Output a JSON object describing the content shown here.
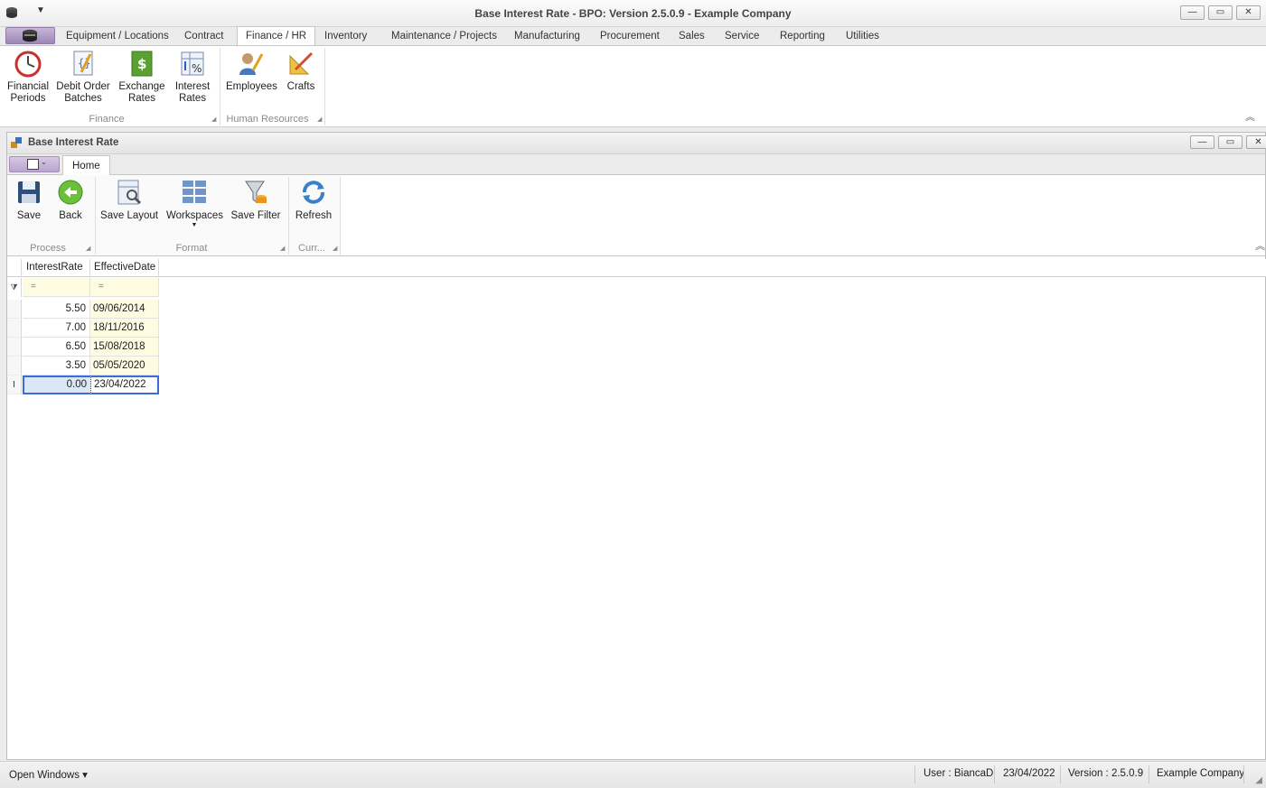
{
  "window": {
    "title": "Base Interest Rate - BPO: Version 2.5.0.9 - Example Company",
    "minimize": "—",
    "maximize": "▭",
    "close": "✕"
  },
  "main_tabs": [
    {
      "label": "Equipment / Locations"
    },
    {
      "label": "Contract"
    },
    {
      "label": "Finance / HR"
    },
    {
      "label": "Inventory"
    },
    {
      "label": "Maintenance / Projects"
    },
    {
      "label": "Manufacturing"
    },
    {
      "label": "Procurement"
    },
    {
      "label": "Sales"
    },
    {
      "label": "Service"
    },
    {
      "label": "Reporting"
    },
    {
      "label": "Utilities"
    }
  ],
  "ribbon_main": {
    "finance": {
      "group_label": "Finance",
      "financial_periods": "Financial Periods",
      "debit_order_batches": "Debit Order Batches",
      "exchange_rates": "Exchange Rates",
      "interest_rates": "Interest Rates"
    },
    "hr": {
      "group_label": "Human Resources",
      "employees": "Employees",
      "crafts": "Crafts"
    }
  },
  "child": {
    "title": "Base Interest Rate",
    "tab_home": "Home",
    "process": {
      "group_label": "Process",
      "save": "Save",
      "back": "Back"
    },
    "format": {
      "group_label": "Format",
      "save_layout": "Save Layout",
      "workspaces": "Workspaces",
      "save_filter": "Save Filter"
    },
    "curr": {
      "group_label": "Curr...",
      "refresh": "Refresh"
    }
  },
  "grid": {
    "columns": [
      "InterestRate",
      "EffectiveDate"
    ],
    "filter_symbol": "=",
    "rows": [
      {
        "rate": "5.50",
        "date": "09/06/2014"
      },
      {
        "rate": "7.00",
        "date": "18/11/2016"
      },
      {
        "rate": "6.50",
        "date": "15/08/2018"
      },
      {
        "rate": "3.50",
        "date": "05/05/2020"
      },
      {
        "rate": "0.00",
        "date": "23/04/2022"
      }
    ],
    "selected_row_index": 4,
    "selected_indicator": "I"
  },
  "status": {
    "open_windows": "Open Windows ▾",
    "user": "User : BiancaD",
    "date": "23/04/2022",
    "version": "Version : 2.5.0.9",
    "company": "Example Company"
  },
  "colors": {
    "accent_selection": "#3a6dd8",
    "date_column_bg": "#fdfbe2",
    "app_button": "#a48fbc"
  }
}
